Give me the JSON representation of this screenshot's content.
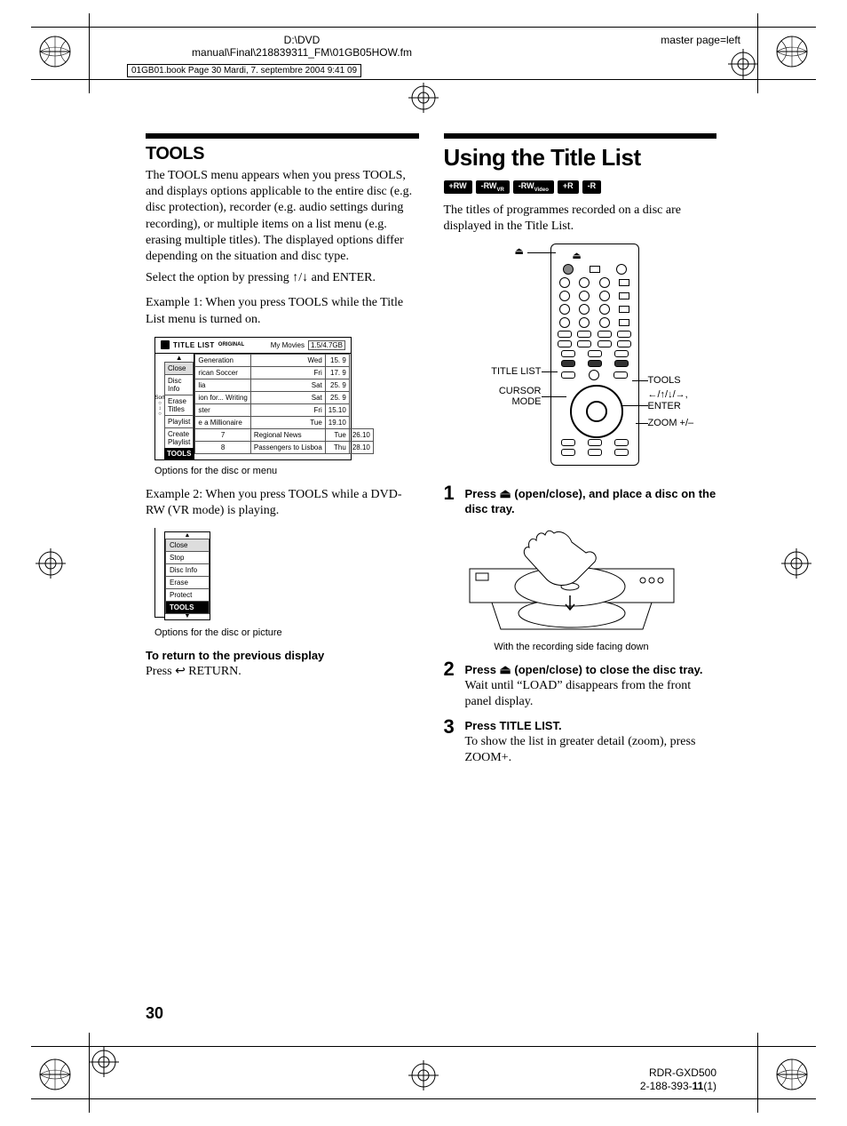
{
  "meta": {
    "path1": "D:\\DVD",
    "path2": "manual\\Final\\218839311_FM\\01GB05HOW.fm",
    "masterpage": "master page=left",
    "header_box": "01GB01.book  Page 30  Mardi, 7. septembre 2004  9:41 09",
    "page_num": "30",
    "foot_model": "RDR-GXD500",
    "foot_rev": "2-188-393-11(1)"
  },
  "left": {
    "heading": "TOOLS",
    "para1": "The TOOLS menu appears when you press TOOLS, and displays options applicable to the entire disc (e.g. disc protection), recorder (e.g. audio settings during recording), or multiple items on a list menu (e.g. erasing multiple titles). The displayed options differ depending on the situation and disc type.",
    "select_line": "Select the option by pressing ↑/↓ and ENTER.",
    "example1": "Example 1: When you press TOOLS while the Title List menu is turned on.",
    "uibox": {
      "title": "TITLE LIST",
      "original": "ORIGINAL",
      "disc_name": "My Movies",
      "capacity": "1.5/4.7GB",
      "menu": [
        "Close",
        "Disc Info",
        "Erase Titles",
        "Playlist",
        "Create Playlist"
      ],
      "menu_footer": "TOOLS",
      "left_label": "Sort",
      "rows": [
        {
          "idx": "",
          "title": "Generation",
          "day": "Wed",
          "date": "15. 9"
        },
        {
          "idx": "",
          "title": "rican Soccer",
          "day": "Fri",
          "date": "17. 9"
        },
        {
          "idx": "",
          "title": "lia",
          "day": "Sat",
          "date": "25. 9"
        },
        {
          "idx": "",
          "title": "ion for... Writing",
          "day": "Sat",
          "date": "25. 9"
        },
        {
          "idx": "",
          "title": "ster",
          "day": "Fri",
          "date": "15.10"
        },
        {
          "idx": "",
          "title": "e a Millionaire",
          "day": "Tue",
          "date": "19.10"
        },
        {
          "idx": "7",
          "title": "Regional News",
          "day": "Tue",
          "date": "26.10"
        },
        {
          "idx": "8",
          "title": "Passengers to Lisboa",
          "day": "Thu",
          "date": "28.10"
        }
      ]
    },
    "caption1": "Options for the disc or menu",
    "example2": "Example 2: When you press TOOLS while a DVD-RW (VR mode) is playing.",
    "uibox2": {
      "menu": [
        "Close",
        "Stop",
        "Disc Info",
        "Erase",
        "Protect"
      ],
      "menu_footer": "TOOLS"
    },
    "caption2": "Options for the disc or picture",
    "sub_heading": "To return to the previous display",
    "return_line": "Press ↩ RETURN."
  },
  "right": {
    "heading": "Using the Title List",
    "tags": [
      "+RW",
      "-RWVR",
      "-RWVideo",
      "+R",
      "-R"
    ],
    "intro": "The titles of programmes recorded on a disc are displayed in the Title List.",
    "remote_labels": {
      "eject": "⏏",
      "title_list": "TITLE LIST",
      "cursor_mode": "CURSOR MODE",
      "tools": "TOOLS",
      "arrows": "←/↑/↓/→, ENTER",
      "zoom": "ZOOM +/–"
    },
    "steps": [
      {
        "head_pre": "Press ",
        "head_post": " (open/close), and place a disc on the disc tray.",
        "body": "",
        "caption": "With the recording side facing down"
      },
      {
        "head_pre": "Press ",
        "head_post": " (open/close) to close the disc tray.",
        "body": "Wait until “LOAD” disappears from the front panel display."
      },
      {
        "head_pre": "Press TITLE LIST.",
        "head_post": "",
        "body": "To show the list in greater detail (zoom), press ZOOM+."
      }
    ]
  }
}
